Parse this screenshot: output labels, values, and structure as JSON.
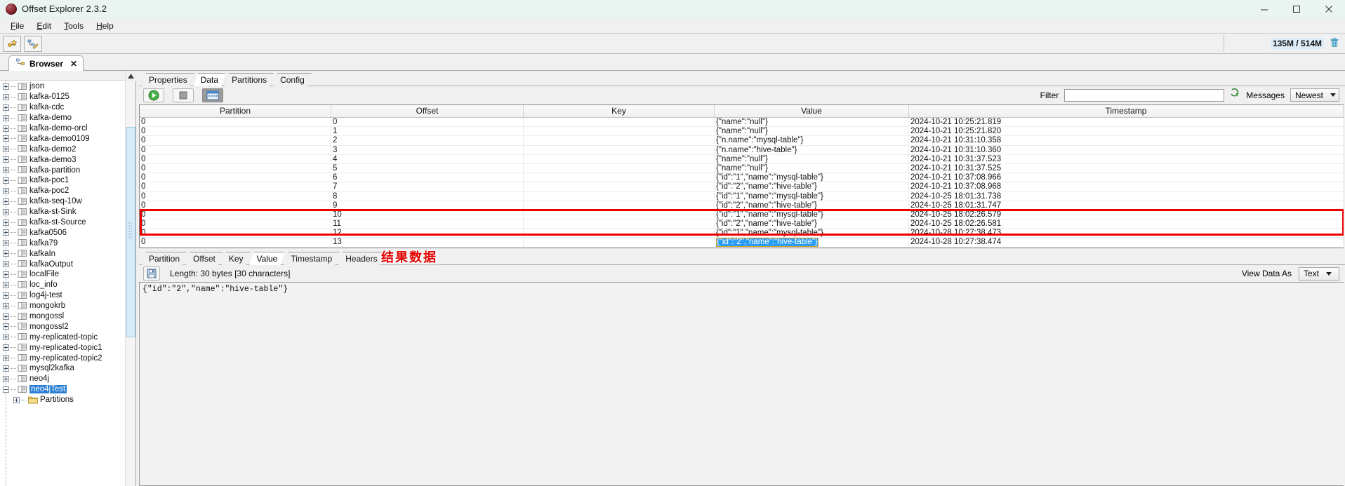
{
  "window": {
    "title": "Offset Explorer  2.3.2",
    "app_icon": "offset-explorer-logo",
    "minimize": "─",
    "maximize": "☐",
    "close": "✕"
  },
  "menubar": {
    "items": [
      "File",
      "Edit",
      "Tools",
      "Help"
    ]
  },
  "toolbar": {
    "buttons": [
      "add-cluster-icon",
      "edit-cluster-icon"
    ],
    "memory": "135M / 514M",
    "trash_icon": "trash-icon"
  },
  "browser_tab": {
    "label": "Browser",
    "icon": "browser-tree-icon",
    "close": "✕"
  },
  "tree": {
    "pin_icon": "pin-icon",
    "items": [
      {
        "label": "json",
        "indent": 0,
        "expander": "plus",
        "icon": "topic-icon",
        "selected": false
      },
      {
        "label": "kafka-0125",
        "indent": 0,
        "expander": "plus",
        "icon": "topic-icon",
        "selected": false
      },
      {
        "label": "kafka-cdc",
        "indent": 0,
        "expander": "plus",
        "icon": "topic-icon",
        "selected": false
      },
      {
        "label": "kafka-demo",
        "indent": 0,
        "expander": "plus",
        "icon": "topic-icon",
        "selected": false
      },
      {
        "label": "kafka-demo-orcl",
        "indent": 0,
        "expander": "plus",
        "icon": "topic-icon",
        "selected": false
      },
      {
        "label": "kafka-demo0109",
        "indent": 0,
        "expander": "plus",
        "icon": "topic-icon",
        "selected": false
      },
      {
        "label": "kafka-demo2",
        "indent": 0,
        "expander": "plus",
        "icon": "topic-icon",
        "selected": false
      },
      {
        "label": "kafka-demo3",
        "indent": 0,
        "expander": "plus",
        "icon": "topic-icon",
        "selected": false
      },
      {
        "label": "kafka-partition",
        "indent": 0,
        "expander": "plus",
        "icon": "topic-icon",
        "selected": false
      },
      {
        "label": "kafka-poc1",
        "indent": 0,
        "expander": "plus",
        "icon": "topic-icon",
        "selected": false
      },
      {
        "label": "kafka-poc2",
        "indent": 0,
        "expander": "plus",
        "icon": "topic-icon",
        "selected": false
      },
      {
        "label": "kafka-seq-10w",
        "indent": 0,
        "expander": "plus",
        "icon": "topic-icon",
        "selected": false
      },
      {
        "label": "kafka-st-Sink",
        "indent": 0,
        "expander": "plus",
        "icon": "topic-icon",
        "selected": false
      },
      {
        "label": "kafka-st-Source",
        "indent": 0,
        "expander": "plus",
        "icon": "topic-icon",
        "selected": false
      },
      {
        "label": "kafka0506",
        "indent": 0,
        "expander": "plus",
        "icon": "topic-icon",
        "selected": false
      },
      {
        "label": "kafka79",
        "indent": 0,
        "expander": "plus",
        "icon": "topic-icon",
        "selected": false
      },
      {
        "label": "kafkaIn",
        "indent": 0,
        "expander": "plus",
        "icon": "topic-icon",
        "selected": false
      },
      {
        "label": "kafkaOutput",
        "indent": 0,
        "expander": "plus",
        "icon": "topic-icon",
        "selected": false
      },
      {
        "label": "localFile",
        "indent": 0,
        "expander": "plus",
        "icon": "topic-icon",
        "selected": false
      },
      {
        "label": "loc_info",
        "indent": 0,
        "expander": "plus",
        "icon": "topic-icon",
        "selected": false
      },
      {
        "label": "log4j-test",
        "indent": 0,
        "expander": "plus",
        "icon": "topic-icon",
        "selected": false
      },
      {
        "label": "mongokrb",
        "indent": 0,
        "expander": "plus",
        "icon": "topic-icon",
        "selected": false
      },
      {
        "label": "mongossl",
        "indent": 0,
        "expander": "plus",
        "icon": "topic-icon",
        "selected": false
      },
      {
        "label": "mongossl2",
        "indent": 0,
        "expander": "plus",
        "icon": "topic-icon",
        "selected": false
      },
      {
        "label": "my-replicated-topic",
        "indent": 0,
        "expander": "plus",
        "icon": "topic-icon",
        "selected": false
      },
      {
        "label": "my-replicated-topic1",
        "indent": 0,
        "expander": "plus",
        "icon": "topic-icon",
        "selected": false
      },
      {
        "label": "my-replicated-topic2",
        "indent": 0,
        "expander": "plus",
        "icon": "topic-icon",
        "selected": false
      },
      {
        "label": "mysql2kafka",
        "indent": 0,
        "expander": "plus",
        "icon": "topic-icon",
        "selected": false
      },
      {
        "label": "neo4j",
        "indent": 0,
        "expander": "plus",
        "icon": "topic-icon",
        "selected": false
      },
      {
        "label": "neo4jTest",
        "indent": 0,
        "expander": "minus",
        "icon": "topic-icon",
        "selected": true
      },
      {
        "label": "Partitions",
        "indent": 1,
        "expander": "plus",
        "icon": "folder-icon",
        "selected": false
      }
    ]
  },
  "content_tabs": {
    "items": [
      "Properties",
      "Data",
      "Partitions",
      "Config"
    ],
    "active": "Data"
  },
  "runbar": {
    "play_icon": "play-icon",
    "stop_icon": "stop-icon",
    "columns_icon": "columns-icon",
    "filter_label": "Filter",
    "filter_value": "",
    "filter_placeholder": "",
    "refresh_icon": "refresh-down-icon",
    "messages_label": "Messages",
    "messages_value": "Newest"
  },
  "grid": {
    "columns": [
      "Partition",
      "Offset",
      "Key",
      "Value",
      "Timestamp"
    ],
    "rows": [
      {
        "partition": "0",
        "offset": "0",
        "key": "",
        "value": "{\"name\":\"null\"}",
        "timestamp": "2024-10-21 10:25:21.819",
        "selected": false
      },
      {
        "partition": "0",
        "offset": "1",
        "key": "",
        "value": "{\"name\":\"null\"}",
        "timestamp": "2024-10-21 10:25:21.820",
        "selected": false
      },
      {
        "partition": "0",
        "offset": "2",
        "key": "",
        "value": "{\"n.name\":\"mysql-table\"}",
        "timestamp": "2024-10-21 10:31:10.358",
        "selected": false
      },
      {
        "partition": "0",
        "offset": "3",
        "key": "",
        "value": "{\"n.name\":\"hive-table\"}",
        "timestamp": "2024-10-21 10:31:10.360",
        "selected": false
      },
      {
        "partition": "0",
        "offset": "4",
        "key": "",
        "value": "{\"name\":\"null\"}",
        "timestamp": "2024-10-21 10:31:37.523",
        "selected": false
      },
      {
        "partition": "0",
        "offset": "5",
        "key": "",
        "value": "{\"name\":\"null\"}",
        "timestamp": "2024-10-21 10:31:37.525",
        "selected": false
      },
      {
        "partition": "0",
        "offset": "6",
        "key": "",
        "value": "{\"id\":\"1\",\"name\":\"mysql-table\"}",
        "timestamp": "2024-10-21 10:37:08.966",
        "selected": false
      },
      {
        "partition": "0",
        "offset": "7",
        "key": "",
        "value": "{\"id\":\"2\",\"name\":\"hive-table\"}",
        "timestamp": "2024-10-21 10:37:08.968",
        "selected": false
      },
      {
        "partition": "0",
        "offset": "8",
        "key": "",
        "value": "{\"id\":\"1\",\"name\":\"mysql-table\"}",
        "timestamp": "2024-10-25 18:01:31.738",
        "selected": false
      },
      {
        "partition": "0",
        "offset": "9",
        "key": "",
        "value": "{\"id\":\"2\",\"name\":\"hive-table\"}",
        "timestamp": "2024-10-25 18:01:31.747",
        "selected": false
      },
      {
        "partition": "0",
        "offset": "10",
        "key": "",
        "value": "{\"id\":\"1\",\"name\":\"mysql-table\"}",
        "timestamp": "2024-10-25 18:02:26.579",
        "selected": false
      },
      {
        "partition": "0",
        "offset": "11",
        "key": "",
        "value": "{\"id\":\"2\",\"name\":\"hive-table\"}",
        "timestamp": "2024-10-25 18:02:26.581",
        "selected": false
      },
      {
        "partition": "0",
        "offset": "12",
        "key": "",
        "value": "{\"id\":\"1\",\"name\":\"mysql-table\"}",
        "timestamp": "2024-10-28 10:27:38.473",
        "selected": false
      },
      {
        "partition": "0",
        "offset": "13",
        "key": "",
        "value": "{\"id\":\"2\",\"name\":\"hive-table\"}",
        "timestamp": "2024-10-28 10:27:38.474",
        "selected": true
      }
    ]
  },
  "annotation": {
    "text": "结果数据",
    "color": "#ee0000",
    "highlight_box_color": "#ee0000"
  },
  "detail": {
    "tabs": [
      "Partition",
      "Offset",
      "Key",
      "Value",
      "Timestamp",
      "Headers"
    ],
    "active": "Value",
    "save_icon": "save-disk-icon",
    "length_label": "Length: 30 bytes [30 characters]",
    "view_as_label": "View Data As",
    "view_as_value": "Text",
    "content": "{\"id\":\"2\",\"name\":\"hive-table\"}"
  }
}
